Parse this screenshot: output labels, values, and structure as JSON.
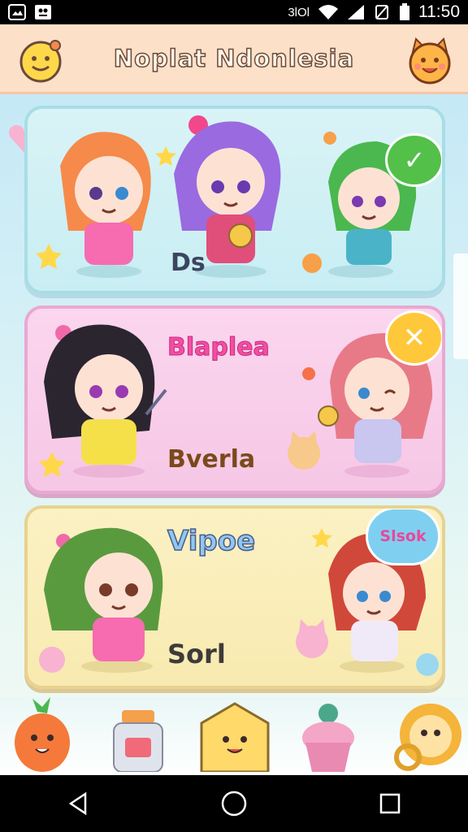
{
  "status_bar": {
    "time": "11:50",
    "signal_text": "3lOl",
    "icons": [
      "image-icon",
      "notification-icon",
      "vibrate-icon",
      "wifi-icon",
      "cell-signal-icon",
      "no-sim-icon",
      "battery-icon"
    ]
  },
  "app_bar": {
    "title": "Noplat Ndonlesia",
    "left_icon": "emoji-face-icon",
    "right_icon": "cat-face-icon"
  },
  "cards": [
    {
      "label": "Ds",
      "bubble_icon": "check-icon",
      "bubble_color": "#53c04a"
    },
    {
      "label_top": "Blaplea",
      "label_bottom": "Bverla",
      "bubble_icon": "close-icon",
      "bubble_color": "#ffc83a"
    },
    {
      "label_top": "Vipoe",
      "label_bottom": "Sorl",
      "bubble_text": "Slsok",
      "bubble_color": "#7fd0f0"
    }
  ],
  "dock": {
    "items": [
      "carrot-character-icon",
      "jar-icon",
      "home-icon",
      "cupcake-icon",
      "lion-character-icon"
    ]
  },
  "nav_bar": {
    "buttons": [
      "back-icon",
      "home-circle-icon",
      "recents-icon"
    ]
  },
  "colors": {
    "app_bar_bg": "#fde0c8",
    "card1_bg": "#c8eef3",
    "card2_bg": "#f6c7e6",
    "card3_bg": "#f8eab0",
    "accent_pink": "#f24fa3"
  }
}
